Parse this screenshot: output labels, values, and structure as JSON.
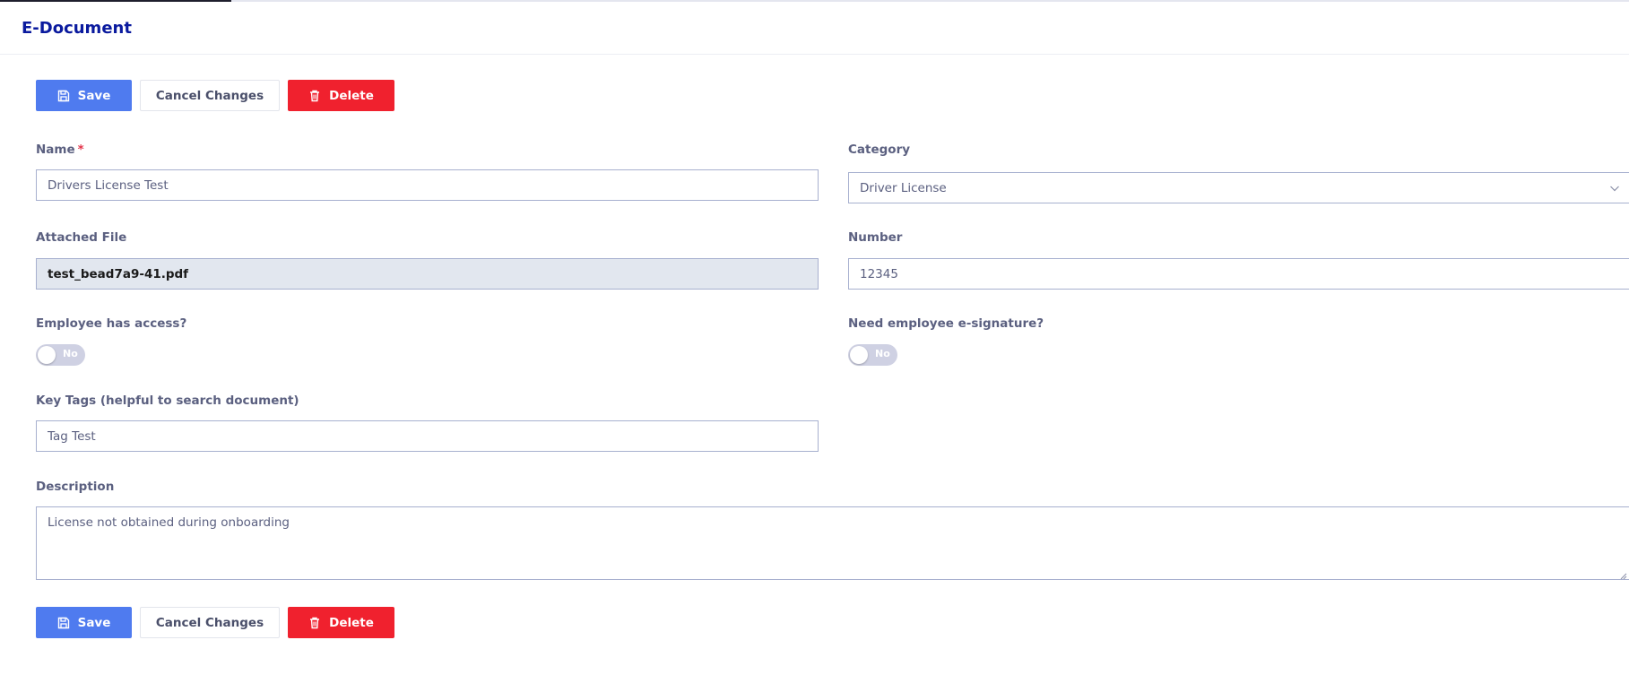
{
  "page": {
    "title": "E-Document"
  },
  "toolbar": {
    "save_label": "Save",
    "cancel_label": "Cancel Changes",
    "delete_label": "Delete"
  },
  "form": {
    "name": {
      "label": "Name",
      "required_mark": "*",
      "value": "Drivers License Test"
    },
    "category": {
      "label": "Category",
      "value": "Driver License"
    },
    "attached_file": {
      "label": "Attached File",
      "value": "test_bead7a9-41.pdf"
    },
    "number": {
      "label": "Number",
      "value": "12345"
    },
    "employee_access": {
      "label": "Employee has access?",
      "state": "No"
    },
    "e_signature": {
      "label": "Need employee e-signature?",
      "state": "No"
    },
    "key_tags": {
      "label": "Key Tags (helpful to search document)",
      "value": "Tag Test"
    },
    "description": {
      "label": "Description",
      "value": "License not obtained during onboarding"
    }
  },
  "colors": {
    "title": "#0a1a9e",
    "save_button": "#4f7bef",
    "delete_button": "#f0212e",
    "toggle_off": "#cfd1e3",
    "required": "#e3344a"
  },
  "icons": {
    "save": "floppy-disk-icon",
    "delete": "trash-icon",
    "category_dropdown": "chevron-down-icon"
  }
}
